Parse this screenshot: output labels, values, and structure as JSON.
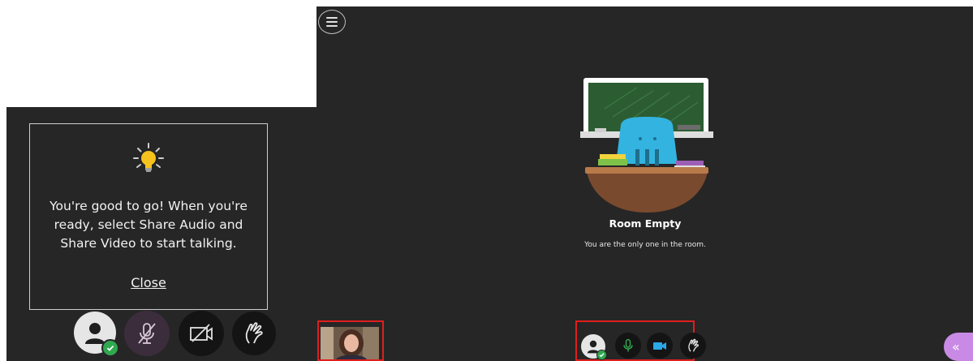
{
  "tooltip": {
    "message": "You're good to go! When you're ready, select Share Audio and Share Video to start talking.",
    "close_label": "Close",
    "icon": "lightbulb-icon"
  },
  "controls": {
    "avatar": {
      "icon": "user-avatar-icon",
      "status_icon": "check-icon",
      "status_color": "#2fa84f"
    },
    "microphone": {
      "icon": "microphone-muted-icon",
      "state": "muted"
    },
    "camera": {
      "icon": "camera-off-icon",
      "state": "off"
    },
    "raise_hand": {
      "icon": "raise-hand-icon"
    }
  },
  "room": {
    "title": "Room Empty",
    "subtitle": "You are the only one in the room.",
    "illustration": "empty-classroom-illustration"
  },
  "session_controls": {
    "avatar": {
      "icon": "user-avatar-icon",
      "status_icon": "check-icon"
    },
    "microphone": {
      "icon": "microphone-icon",
      "state": "on",
      "color": "#2fa84f"
    },
    "camera": {
      "icon": "camera-icon",
      "state": "on",
      "color": "#2aa8e8"
    },
    "raise_hand": {
      "icon": "raise-hand-icon"
    }
  },
  "menu": {
    "icon": "hamburger-menu-icon"
  },
  "panel_toggle": {
    "icon": "double-chevron-left-icon",
    "label": "«",
    "color": "#c98ae6"
  },
  "highlight_color": "#e01e1e"
}
